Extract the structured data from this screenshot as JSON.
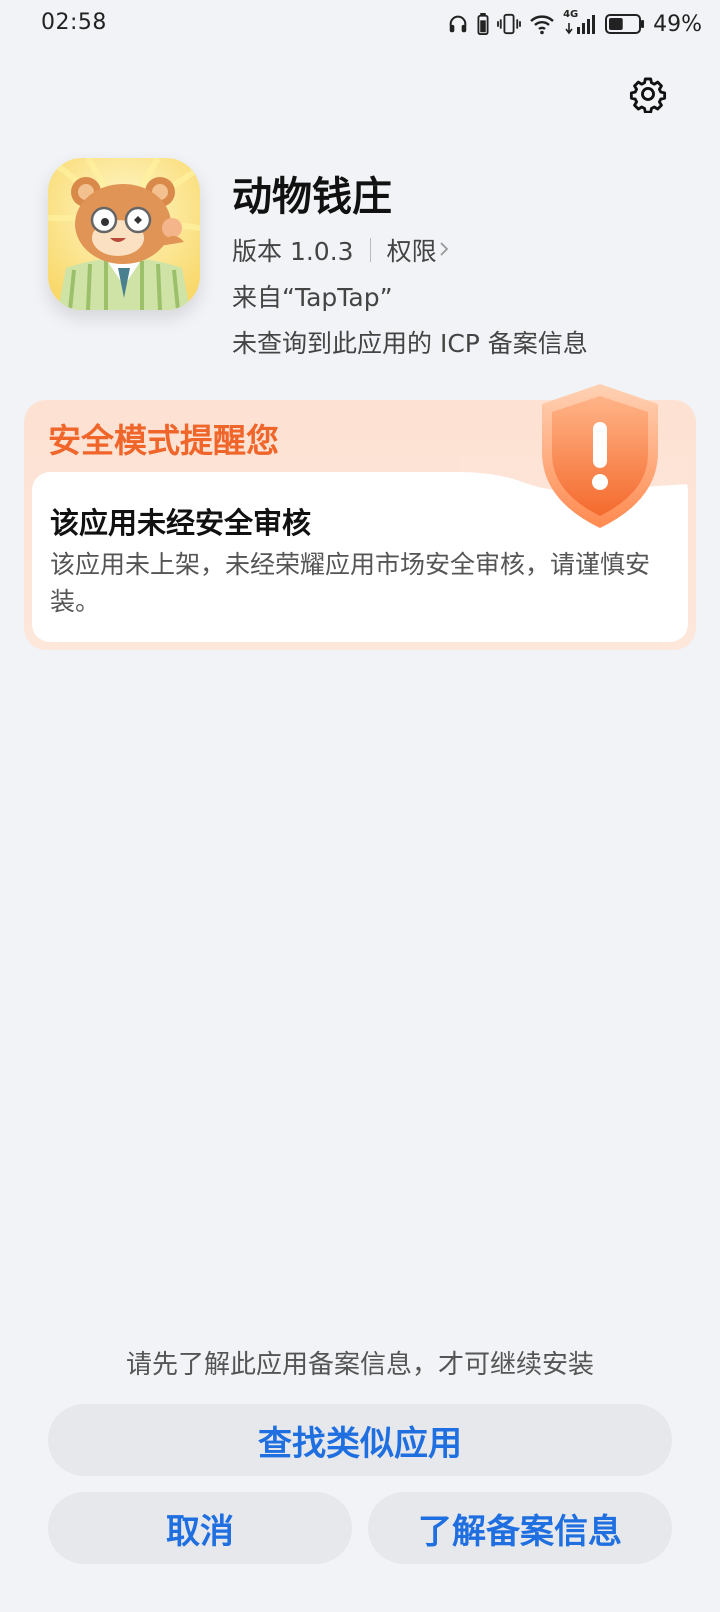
{
  "status_bar": {
    "time": "02:58",
    "battery_percent": "49%",
    "network_label": "4G",
    "battery_level": 0.49,
    "icons": [
      "headphones-icon",
      "battery-small-icon",
      "vibrate-icon",
      "wifi-icon",
      "signal-icon",
      "battery-icon"
    ]
  },
  "app": {
    "name": "动物钱庄",
    "version": "版本 1.0.3",
    "permissions_label": "权限",
    "source": "来自“TapTap”",
    "icp_notice": "未查询到此应用的 ICP 备案信息"
  },
  "warning": {
    "title": "安全模式提醒您",
    "headline": "该应用未经安全审核",
    "body": "该应用未上架，未经荣耀应用市场安全审核，请谨慎安装。",
    "accent_color": "#f0652a"
  },
  "footer": {
    "hint": "请先了解此应用备案信息，才可继续安装",
    "find_similar_label": "查找类似应用",
    "cancel_label": "取消",
    "learn_record_label": "了解备案信息",
    "button_text_color": "#1f6fe0"
  }
}
